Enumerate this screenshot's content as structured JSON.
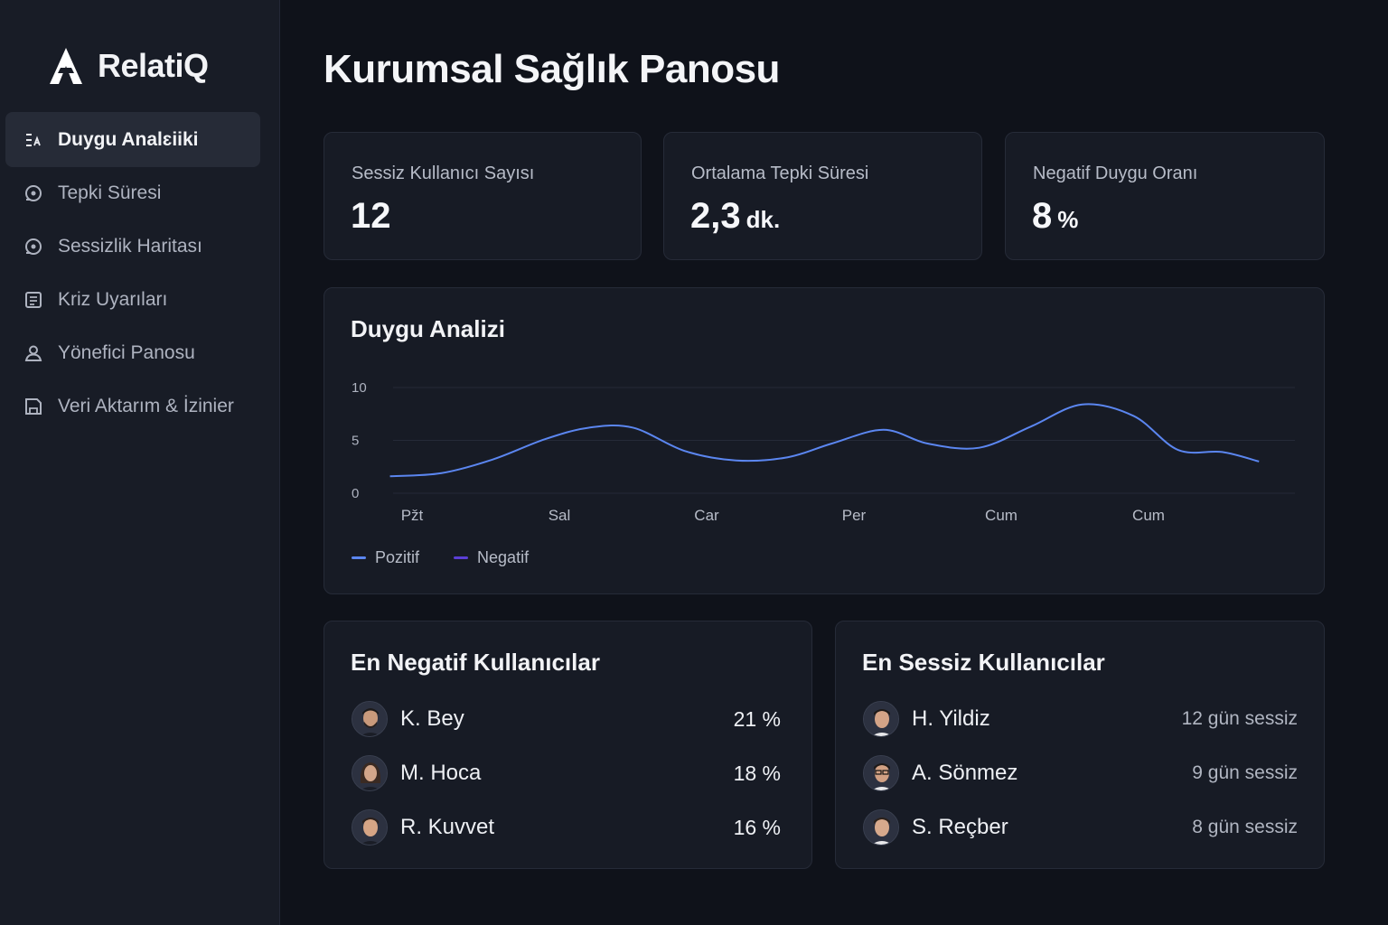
{
  "brand": {
    "name": "RelatiQ"
  },
  "sidebar": {
    "items": [
      {
        "label": "Duygu Analɛiiki",
        "icon": "chart-icon",
        "active": true
      },
      {
        "label": "Tepki Süresi",
        "icon": "gauge-icon",
        "active": false
      },
      {
        "label": "Sessizlik Haritası",
        "icon": "gauge-icon",
        "active": false
      },
      {
        "label": "Kriz Uyarıları",
        "icon": "list-icon",
        "active": false
      },
      {
        "label": "Yönefici Panosu",
        "icon": "user-icon",
        "active": false
      },
      {
        "label": "Veri Aktarım & İzinier",
        "icon": "folder-icon",
        "active": false
      }
    ]
  },
  "page": {
    "title": "Kurumsal Sağlık Panosu"
  },
  "kpis": [
    {
      "label": "Sessiz Kullanıcı Sayısı",
      "value": "12",
      "unit": ""
    },
    {
      "label": "Ortalama Tepki Süresi",
      "value": "2,3",
      "unit": "dk."
    },
    {
      "label": "Negatif Duygu Oranı",
      "value": "8",
      "unit": "%"
    }
  ],
  "chart_card": {
    "title": "Duygu Analizi"
  },
  "chart_data": {
    "type": "line",
    "categories": [
      "Pžt",
      "Sal",
      "Car",
      "Per",
      "Cum",
      "Cum"
    ],
    "yticks": [
      0,
      5,
      10
    ],
    "ylim": [
      0,
      10
    ],
    "grid": true,
    "legend_position": "bottom-left",
    "series": [
      {
        "name": "Pozitif",
        "color": "#5b86f0",
        "x": [
          -0.15,
          0.2,
          0.55,
          0.9,
          1.2,
          1.5,
          1.85,
          2.2,
          2.55,
          2.85,
          3.2,
          3.5,
          3.85,
          4.2,
          4.55,
          4.9,
          5.2,
          5.5,
          5.75
        ],
        "values": [
          1.6,
          1.9,
          3.2,
          5.1,
          6.2,
          6.2,
          4.0,
          3.1,
          3.4,
          4.7,
          6.0,
          4.7,
          4.3,
          6.3,
          8.4,
          7.3,
          4.1,
          3.9,
          3.0
        ]
      },
      {
        "name": "Negatif",
        "color": "#5b3fd6",
        "x": [],
        "values": []
      }
    ]
  },
  "negative_users": {
    "title": "En Negatif Kullanıcılar",
    "rows": [
      {
        "name": "K. Bey",
        "value": "21 %"
      },
      {
        "name": "M. Hoca",
        "value": "18 %"
      },
      {
        "name": "R. Kuvvet",
        "value": "16 %"
      }
    ]
  },
  "silent_users": {
    "title": "En Sessiz Kullanıcılar",
    "rows": [
      {
        "name": "H. Yildiz",
        "value": "12 gün sessiz"
      },
      {
        "name": "A. Sönmez",
        "value": "9 gün sessiz"
      },
      {
        "name": "S. Reçber",
        "value": "8 gün sessiz"
      }
    ]
  }
}
